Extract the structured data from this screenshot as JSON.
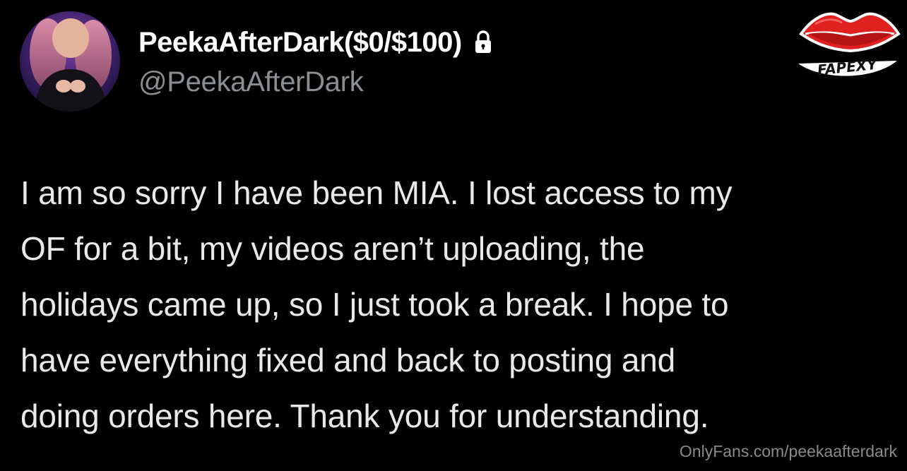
{
  "profile": {
    "display_name": "PeekaAfterDark($0/$100)",
    "handle": "@PeekaAfterDark",
    "protected_icon": "lock-icon",
    "avatar": "profile-photo"
  },
  "brand_logo": {
    "text": "FAPEXY",
    "icon": "lips-icon",
    "color": "#e0211f"
  },
  "tweet": {
    "text": "I am so sorry I have been MIA. I lost access to my\nOF for a bit, my videos aren’t uploading, the\nholidays came up, so I just took a break. I hope to\nhave everything fixed and back to posting and\ndoing orders here. Thank you for understanding."
  },
  "watermark": {
    "text": "OnlyFans.com/peekaafterdark"
  },
  "colors": {
    "background": "#000000",
    "primary_text": "#ffffff",
    "secondary_text": "#8b8f94"
  }
}
